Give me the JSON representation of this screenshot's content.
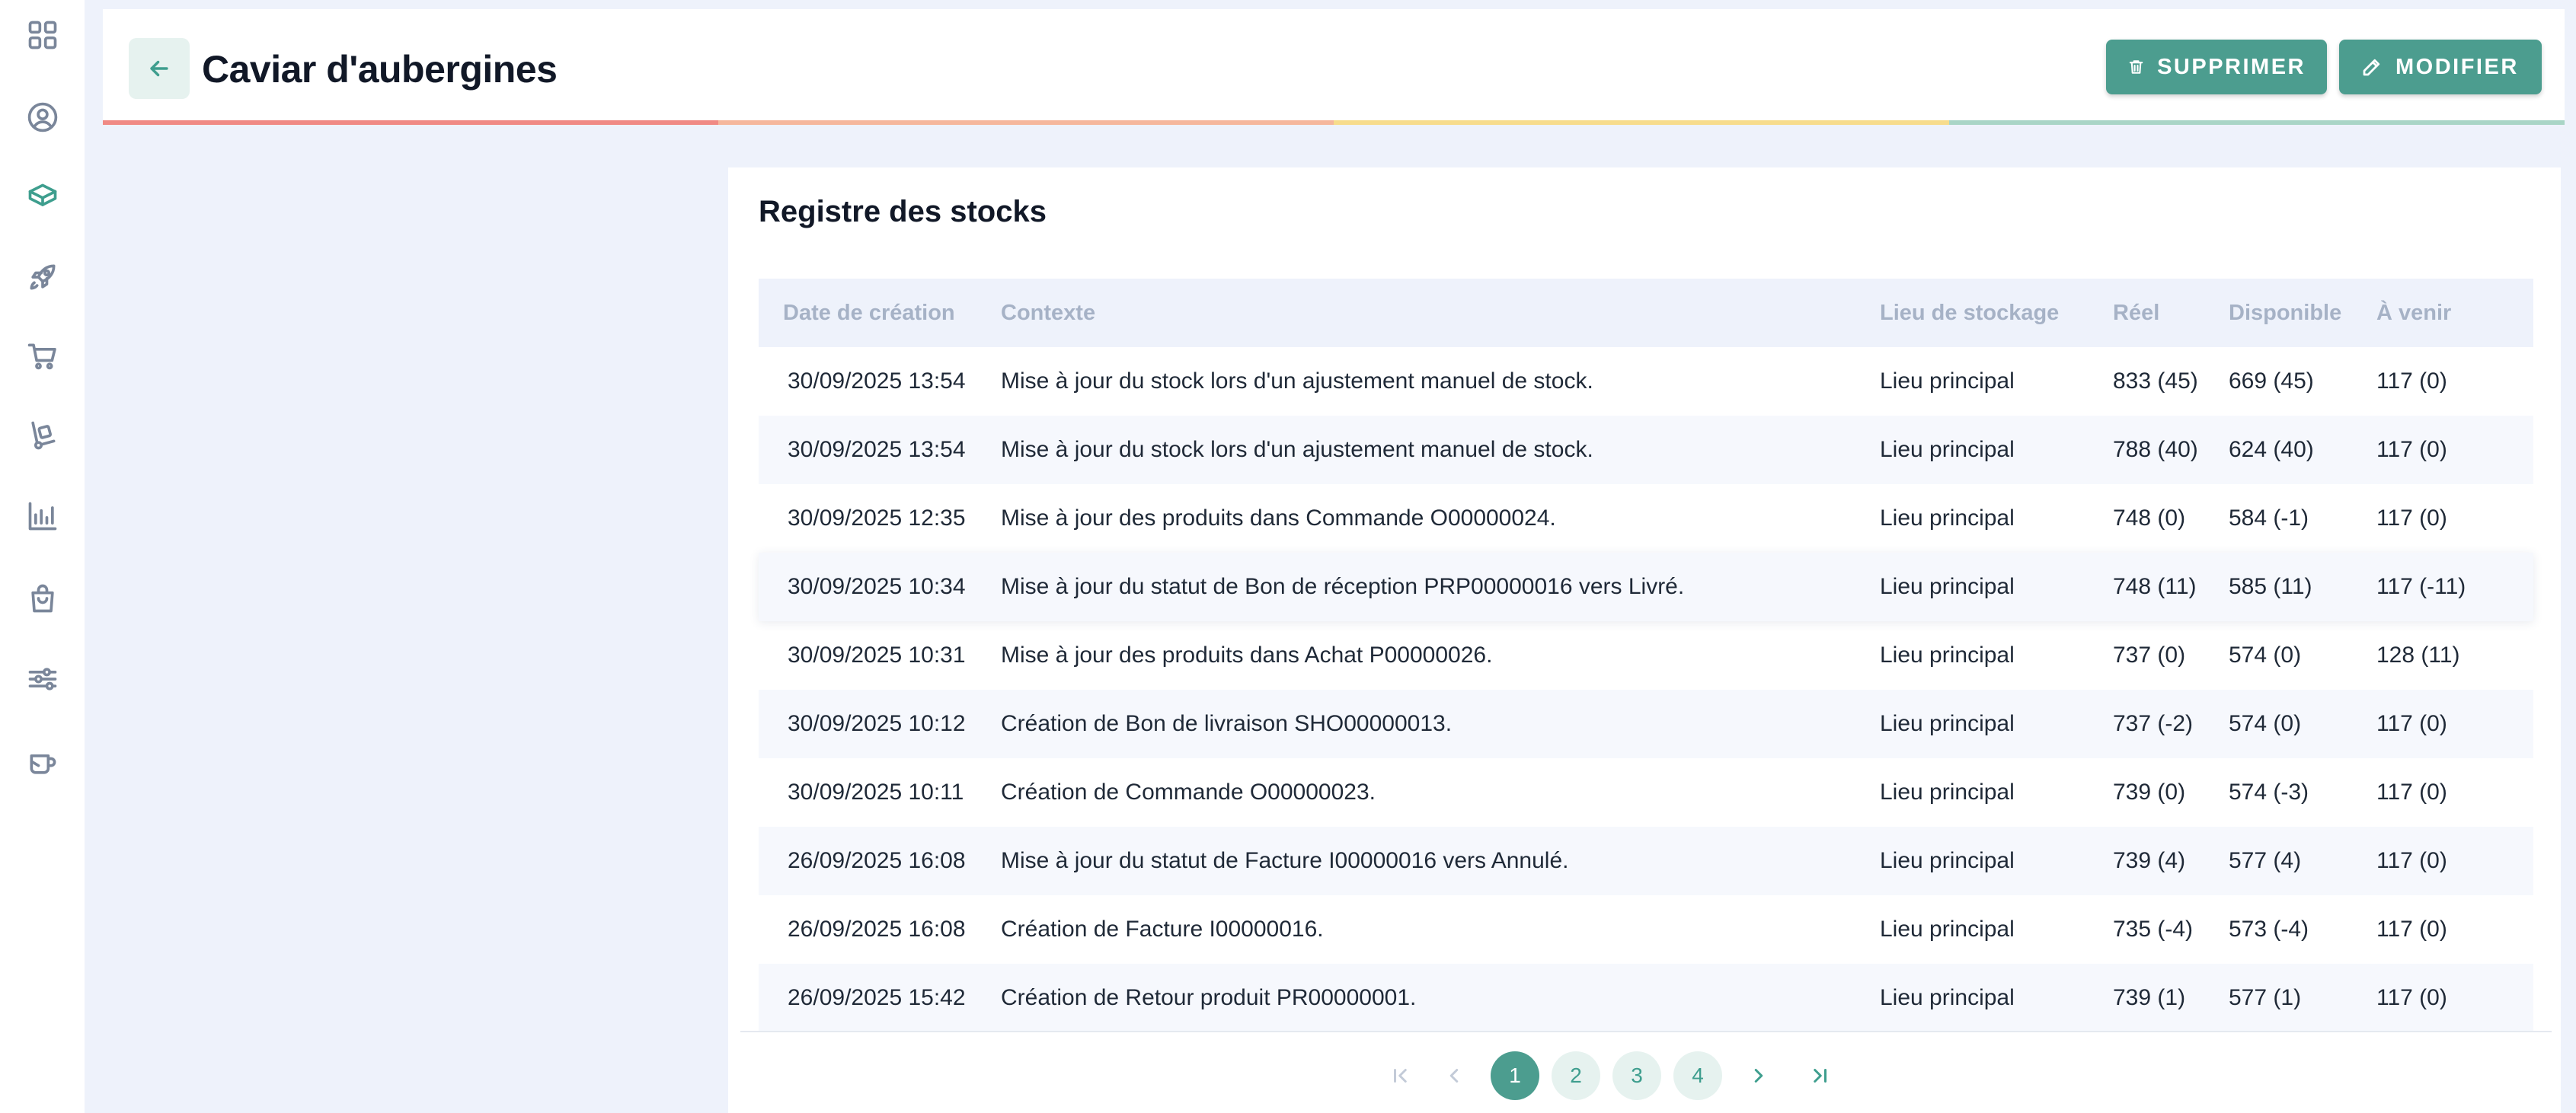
{
  "sidebar": {
    "items": [
      {
        "icon": "grid-icon",
        "active": false
      },
      {
        "icon": "user-circle-icon",
        "active": false
      },
      {
        "icon": "box-icon",
        "active": true
      },
      {
        "icon": "rocket-icon",
        "active": false
      },
      {
        "icon": "cart-icon",
        "active": false
      },
      {
        "icon": "hand-truck-icon",
        "active": false
      },
      {
        "icon": "bar-chart-icon",
        "active": false
      },
      {
        "icon": "shopping-bag-icon",
        "active": false
      },
      {
        "icon": "sliders-icon",
        "active": false
      },
      {
        "icon": "mug-icon",
        "active": false
      }
    ]
  },
  "header": {
    "title": "Caviar d'aubergines",
    "delete_label": "SUPPRIMER",
    "edit_label": "MODIFIER",
    "strip_colors": [
      "#f08a84",
      "#f5b79c",
      "#f7dc8c",
      "#a9d5c6"
    ]
  },
  "register": {
    "title": "Registre des stocks",
    "columns": [
      "Date de création",
      "Contexte",
      "Lieu de stockage",
      "Réel",
      "Disponible",
      "À venir"
    ],
    "rows": [
      {
        "date": "30/09/2025 13:54",
        "context": "Mise à jour du stock lors d'un ajustement manuel de stock.",
        "location": "Lieu principal",
        "real": "833 (45)",
        "available": "669 (45)",
        "upcoming": "117 (0)"
      },
      {
        "date": "30/09/2025 13:54",
        "context": "Mise à jour du stock lors d'un ajustement manuel de stock.",
        "location": "Lieu principal",
        "real": "788 (40)",
        "available": "624 (40)",
        "upcoming": "117 (0)"
      },
      {
        "date": "30/09/2025 12:35",
        "context": "Mise à jour des produits dans Commande O00000024.",
        "location": "Lieu principal",
        "real": "748 (0)",
        "available": "584 (-1)",
        "upcoming": "117 (0)"
      },
      {
        "date": "30/09/2025 10:34",
        "context": "Mise à jour du statut de Bon de réception PRP00000016 vers Livré.",
        "location": "Lieu principal",
        "real": "748 (11)",
        "available": "585 (11)",
        "upcoming": "117 (-11)"
      },
      {
        "date": "30/09/2025 10:31",
        "context": "Mise à jour des produits dans Achat P00000026.",
        "location": "Lieu principal",
        "real": "737 (0)",
        "available": "574 (0)",
        "upcoming": "128 (11)"
      },
      {
        "date": "30/09/2025 10:12",
        "context": "Création de Bon de livraison SHO00000013.",
        "location": "Lieu principal",
        "real": "737 (-2)",
        "available": "574 (0)",
        "upcoming": "117 (0)"
      },
      {
        "date": "30/09/2025 10:11",
        "context": "Création de Commande O00000023.",
        "location": "Lieu principal",
        "real": "739 (0)",
        "available": "574 (-3)",
        "upcoming": "117 (0)"
      },
      {
        "date": "26/09/2025 16:08",
        "context": "Mise à jour du statut de Facture I00000016 vers Annulé.",
        "location": "Lieu principal",
        "real": "739 (4)",
        "available": "577 (4)",
        "upcoming": "117 (0)"
      },
      {
        "date": "26/09/2025 16:08",
        "context": "Création de Facture I00000016.",
        "location": "Lieu principal",
        "real": "735 (-4)",
        "available": "573 (-4)",
        "upcoming": "117 (0)"
      },
      {
        "date": "26/09/2025 15:42",
        "context": "Création de Retour produit PR00000001.",
        "location": "Lieu principal",
        "real": "739 (1)",
        "available": "577 (1)",
        "upcoming": "117 (0)"
      }
    ]
  },
  "pagination": {
    "pages": [
      "1",
      "2",
      "3",
      "4"
    ],
    "current": "1"
  }
}
